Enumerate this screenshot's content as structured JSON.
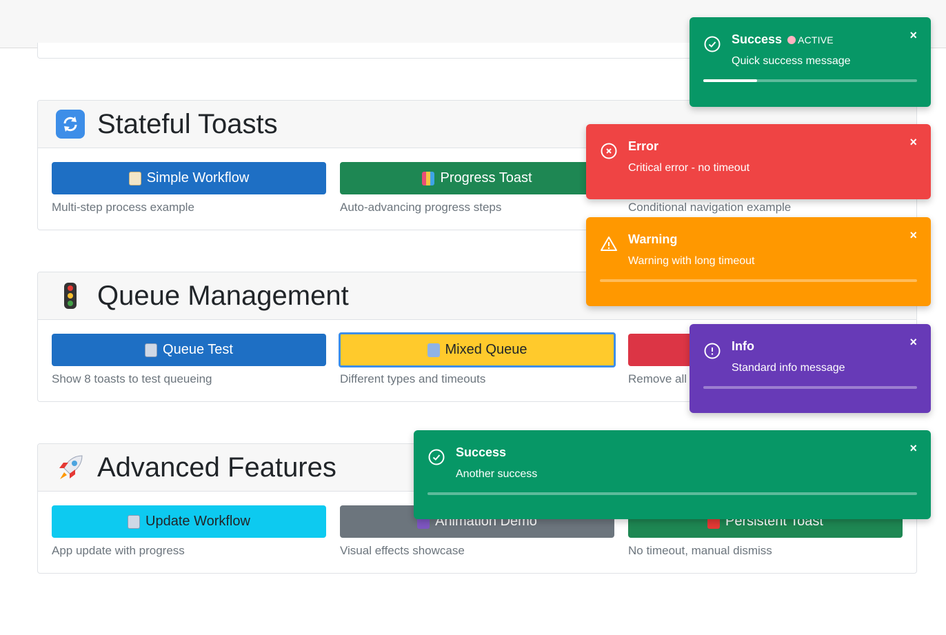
{
  "sections": {
    "stateful": {
      "title": "Stateful Toasts",
      "icon": "arrows-cycle-icon",
      "buttons": [
        {
          "label": "Simple Workflow",
          "desc": "Multi-step process example"
        },
        {
          "label": "Progress Toast",
          "desc": "Auto-advancing progress steps"
        },
        {
          "desc": "Conditional navigation example"
        }
      ]
    },
    "queue": {
      "title": "Queue Management",
      "icon": "traffic-light-icon",
      "buttons": [
        {
          "label": "Queue Test",
          "desc": "Show 8 toasts to test queueing"
        },
        {
          "label": "Mixed Queue",
          "desc": "Different types and timeouts"
        },
        {
          "desc": "Remove all"
        }
      ]
    },
    "advanced": {
      "title": "Advanced Features",
      "icon": "rocket-icon",
      "buttons": [
        {
          "label": "Update Workflow",
          "desc": "App update with progress"
        },
        {
          "label": "Animation Demo",
          "desc": "Visual effects showcase"
        },
        {
          "label": "Persistent Toast",
          "desc": "No timeout, manual dismiss"
        }
      ]
    }
  },
  "toasts": {
    "success1": {
      "title": "Success",
      "badge": "ACTIVE",
      "message": "Quick success message",
      "close": "×",
      "progress": 0.25
    },
    "error": {
      "title": "Error",
      "message": "Critical error - no timeout",
      "close": "×"
    },
    "warning": {
      "title": "Warning",
      "message": "Warning with long timeout",
      "close": "×",
      "progress": 0
    },
    "info": {
      "title": "Info",
      "message": "Standard info message",
      "close": "×",
      "progress": 0
    },
    "success2": {
      "title": "Success",
      "message": "Another success",
      "close": "×",
      "progress": 0
    }
  },
  "colors": {
    "primary": "#1e6fc4",
    "success": "#1e8753",
    "warning_btn": "#ffca2c",
    "danger": "#dc3545",
    "info_btn": "#0dcaf0",
    "secondary": "#6c757d",
    "toast_success": "#079766",
    "toast_error": "#ef4444",
    "toast_warning": "#ff9800",
    "toast_info": "#673ab7"
  }
}
